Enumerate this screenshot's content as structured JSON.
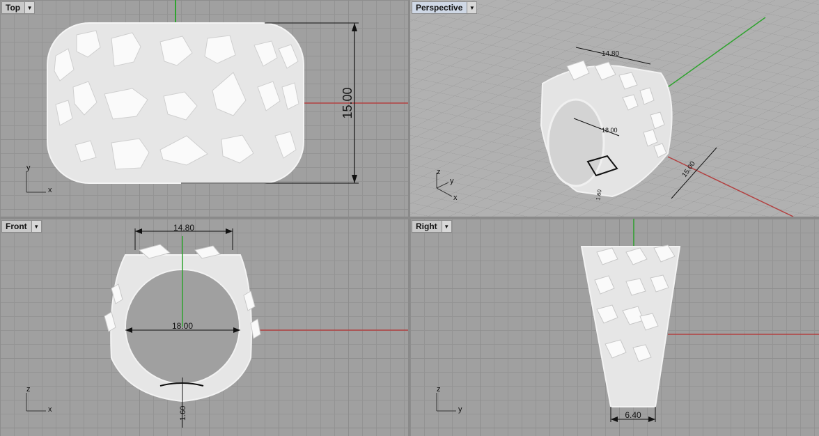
{
  "viewports": {
    "top": {
      "label": "Top",
      "axis_labels": {
        "y": "y",
        "x": "x"
      },
      "dimension": "15.00"
    },
    "perspective": {
      "label": "Perspective",
      "axis_labels": {
        "z": "z",
        "y": "y",
        "x": "x"
      },
      "dimensions": {
        "width": "14.80",
        "inner": "18.00",
        "height": "15.00",
        "thickness": "1.60"
      }
    },
    "front": {
      "label": "Front",
      "axis_labels": {
        "z": "z",
        "x": "x"
      },
      "dimensions": {
        "width": "14.80",
        "inner": "18.00",
        "thickness": "1.60"
      }
    },
    "right": {
      "label": "Right",
      "axis_labels": {
        "z": "z",
        "y": "y"
      },
      "dimension": "6.40"
    }
  },
  "menu_icon": "chevron-down-icon",
  "colors": {
    "x_axis": "#b24040",
    "y_axis": "#2fa32f",
    "grid_bg": "#a0a0a0",
    "model": "#e9e9e9"
  }
}
